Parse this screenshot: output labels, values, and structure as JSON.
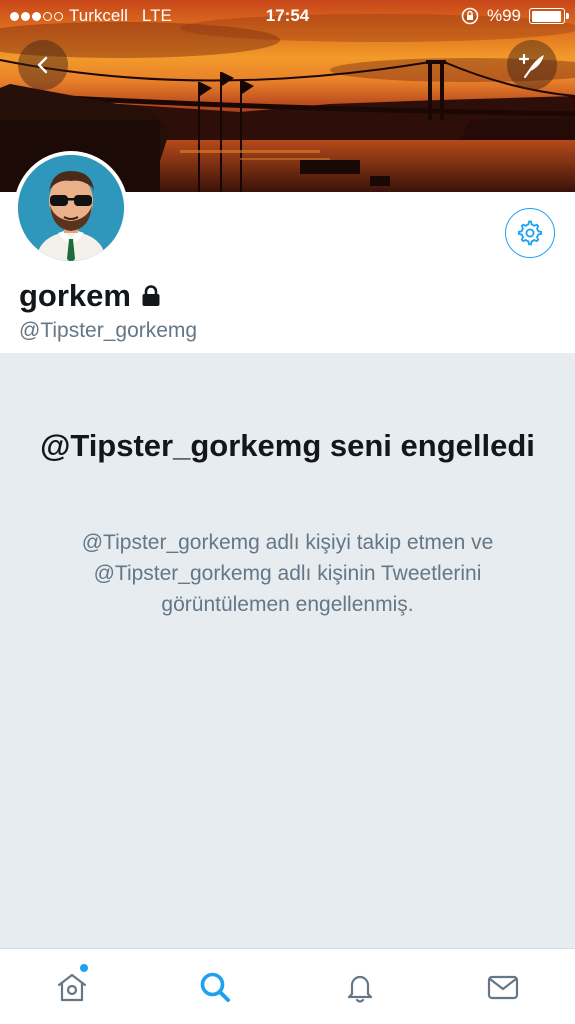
{
  "status_bar": {
    "carrier": "Turkcell",
    "network": "LTE",
    "time": "17:54",
    "battery": "%99",
    "battery_level": 0.99,
    "signal_bars": 3,
    "signal_total": 5
  },
  "header": {
    "back_icon": "chevron-left-icon",
    "compose_icon": "compose-tweet-icon",
    "banner_image": "bosphorus-bridge-sunset"
  },
  "profile": {
    "display_name": "gorkem",
    "username": "@Tipster_gorkemg",
    "protected_icon": "lock-icon",
    "settings_icon": "gear-icon"
  },
  "blocked": {
    "title": "@Tipster_gorkemg seni engelledi",
    "description": "@Tipster_gorkemg adlı kişiyi takip etmen ve @Tipster_gorkemg adlı kişinin Tweetlerini görüntülemen engellenmiş."
  },
  "tab_bar": {
    "tabs": [
      {
        "icon": "home-icon",
        "active": false,
        "has_new": true
      },
      {
        "icon": "search-icon",
        "active": true
      },
      {
        "icon": "bell-icon",
        "active": false
      },
      {
        "icon": "mail-icon",
        "active": false
      }
    ]
  },
  "colors": {
    "accent": "#1da1f2",
    "panel_bg": "#e6ecf0",
    "text_primary": "#14171a",
    "text_secondary": "#657786",
    "icon_inactive": "#657786"
  }
}
